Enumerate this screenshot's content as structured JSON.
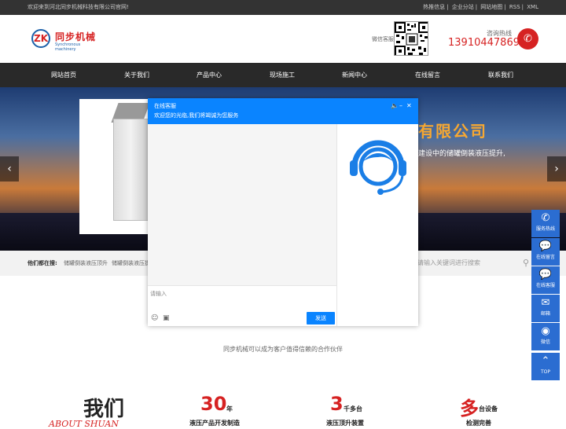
{
  "topbar": {
    "welcome": "欢迎来到河北同步机械科技有限公司官网!",
    "links": [
      "热推信息",
      "企业分站",
      "网站地图",
      "RSS",
      "XML"
    ]
  },
  "header": {
    "logo_cn": "同步机械",
    "logo_en": "Synchronous machinery",
    "logo_mark": "ZK",
    "wechat_label": "微信客服",
    "hotline_label": "咨询热线",
    "hotline_number": "13910447869",
    "phone_icon": "phone-icon"
  },
  "nav": {
    "items": [
      "网站首页",
      "关于我们",
      "产品中心",
      "现场施工",
      "新闻中心",
      "在线留言",
      "联系我们"
    ]
  },
  "banner": {
    "title": "有限公司",
    "subtitle": "建设中的储罐倒装液压提升,",
    "prev": "‹",
    "next": "›"
  },
  "search": {
    "label": "他们都在搜:",
    "keywords": [
      "储罐倒装液压顶升",
      "储罐倒装液压提"
    ],
    "placeholder": "请输入关键词进行搜索"
  },
  "slogan": "同步机械可以成为客户值得信赖的合作伙伴",
  "stats": {
    "women": "我们",
    "about": "ABOUT SHUAN",
    "items": [
      {
        "num": "30",
        "unit": "年",
        "desc": "液压产品开发制造"
      },
      {
        "num": "3",
        "unit": "千多台",
        "desc": "液压顶升装置"
      },
      {
        "num": "多",
        "unit": "台设备",
        "desc": "检测完善"
      }
    ]
  },
  "chat": {
    "title": "在线客服",
    "greeting": "欢迎您的光临,我们将竭诚为您服务",
    "input_placeholder": "请输入",
    "send_label": "发送",
    "controls": [
      "speaker-icon",
      "minimize-icon",
      "close-icon"
    ]
  },
  "float_bar": {
    "items": [
      {
        "label": "服务热线",
        "icon": "phone-icon"
      },
      {
        "label": "在线留言",
        "icon": "chat-icon"
      },
      {
        "label": "在线客服",
        "icon": "chat-icon"
      },
      {
        "label": "邮箱",
        "icon": "mail-icon"
      },
      {
        "label": "微信",
        "icon": "wechat-icon"
      },
      {
        "label": "TOP",
        "icon": "up-arrow-icon"
      }
    ]
  },
  "colors": {
    "accent_red": "#d62222",
    "chat_blue": "#0a84ff",
    "float_blue": "#2b6dd1",
    "nav_bg": "#292929"
  }
}
